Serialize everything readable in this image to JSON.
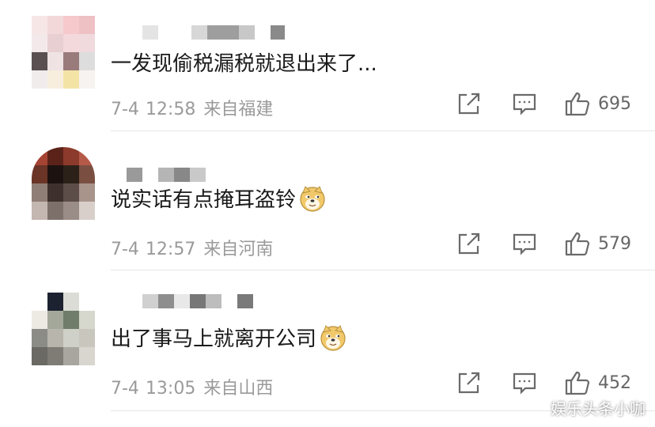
{
  "comments": [
    {
      "text": "一发现偷税漏税就退出来了...",
      "date": "7-4",
      "time": "12:58",
      "location": "来自福建",
      "likes": "695",
      "has_emoji": false,
      "avatar_colors": [
        "#f7e6e6",
        "#f2d8d8",
        "#f6c9cc",
        "#eec1c4",
        "#f3e9ea",
        "#e8cfd2",
        "#f4d9dc",
        "#f0dadd",
        "#5a5052",
        "#efe3e4",
        "#9a7b7b",
        "#dddddd",
        "#f1ecec",
        "#f7eede",
        "#f3e4a6",
        "#f7f3f0"
      ]
    },
    {
      "text": "说实话有点掩耳盗铃",
      "date": "7-4",
      "time": "12:57",
      "location": "来自河南",
      "likes": "579",
      "has_emoji": true,
      "avatar_colors": [
        "#a54433",
        "#5b2219",
        "#8c3a2b",
        "#b55a49",
        "#6a3426",
        "#1c1210",
        "#2c2119",
        "#7a4f42",
        "#8f7e76",
        "#3e302c",
        "#5d4d48",
        "#a9948c",
        "#c4b6b0",
        "#7d6f69",
        "#9a8c86",
        "#d8cfca"
      ]
    },
    {
      "text": "出了事马上就离开公司",
      "date": "7-4",
      "time": "13:05",
      "location": "来自山西",
      "likes": "452",
      "has_emoji": true,
      "avatar_colors": [
        "#ffffff",
        "#1c2230",
        "#dcdcd6",
        "#ffffff",
        "#eceae2",
        "#a3a89a",
        "#6f7d6a",
        "#d6d8ce",
        "#8c8c86",
        "#b8b6ac",
        "#cfd0c8",
        "#c9c6be",
        "#6b6963",
        "#7e7c74",
        "#a8a69e",
        "#d8d6ce"
      ]
    }
  ],
  "watermark": "娱乐头条小咖",
  "icons": {
    "repost": "share-square-icon",
    "comment": "comment-bubble-icon",
    "like": "thumbs-up-icon",
    "emoji": "doge-emoji-icon"
  },
  "colors": {
    "meta": "#9a9a9a",
    "text": "#1a1a1a",
    "divider": "#e6e6e6"
  }
}
